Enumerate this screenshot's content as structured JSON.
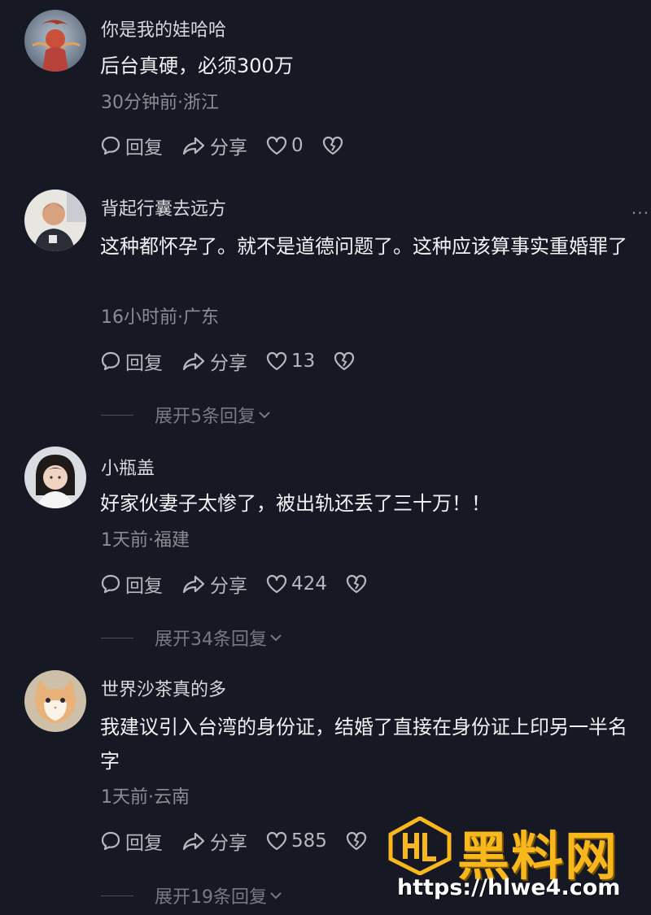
{
  "colors": {
    "background": "#161823",
    "text_primary": "#f1f2f4",
    "text_secondary": "#8b8d94",
    "watermark_gold": "#f7b71d"
  },
  "labels": {
    "reply": "回复",
    "share": "分享"
  },
  "comments": [
    {
      "username": "你是我的娃哈哈",
      "text": "后台真硬，必须300万",
      "meta": "30分钟前·浙江",
      "likes": "0",
      "expand": ""
    },
    {
      "username": "背起行囊去远方",
      "text": "这种都怀孕了。就不是道德问题了。这种应该算事实重婚罪了",
      "meta": "16小时前·广东",
      "likes": "13",
      "expand": "展开5条回复"
    },
    {
      "username": "小瓶盖",
      "text": "好家伙妻子太惨了，被出轨还丢了三十万！！",
      "meta": "1天前·福建",
      "likes": "424",
      "expand": "展开34条回复"
    },
    {
      "username": "世界沙茶真的多",
      "text": "我建议引入台湾的身份证，结婚了直接在身份证上印另一半名字",
      "meta": "1天前·云南",
      "likes": "585",
      "expand": "展开19条回复"
    }
  ],
  "more_menu": "···",
  "icons": {
    "reply": "comment-bubble-icon",
    "share": "share-arrow-icon",
    "like": "heart-icon",
    "dislike": "broken-heart-icon",
    "expand": "chevron-down-icon"
  },
  "watermark": {
    "title": "黑料网",
    "url": "https://hlwe4.com"
  }
}
